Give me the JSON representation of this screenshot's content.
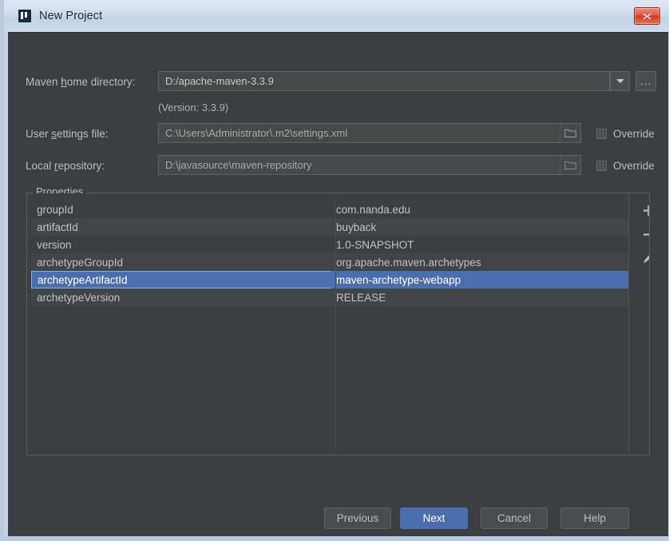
{
  "window": {
    "title": "New Project",
    "app_icon": "intellij-idea-icon",
    "close_label": "close-icon",
    "frame_color": "#b9cbdd",
    "dialog_bg": "#3c3f41"
  },
  "form": {
    "maven_home": {
      "label_pre": "Maven ",
      "label_mnemonic": "h",
      "label_post": "ome directory:",
      "value": "D:/apache-maven-3.3.9",
      "dropdown_icon": "chevron-down-icon",
      "browse_label": "..."
    },
    "version_note": "(Version: 3.3.9)",
    "user_settings": {
      "label_pre": "User ",
      "label_mnemonic": "s",
      "label_post": "ettings file:",
      "value": "C:\\Users\\Administrator\\.m2\\settings.xml",
      "folder_icon": "folder-icon",
      "override_label": "Override",
      "override_checked": false
    },
    "local_repository": {
      "label_pre": "Local ",
      "label_mnemonic": "r",
      "label_post": "epository:",
      "value": "D:\\javasource\\maven-repository",
      "folder_icon": "folder-icon",
      "override_label": "Override",
      "override_checked": false
    }
  },
  "properties": {
    "legend": "Properties",
    "selected_index": 4,
    "selection_color": "#4b6eaf",
    "rows": [
      {
        "key": "groupId",
        "value": "com.nanda.edu"
      },
      {
        "key": "artifactId",
        "value": "buyback"
      },
      {
        "key": "version",
        "value": "1.0-SNAPSHOT"
      },
      {
        "key": "archetypeGroupId",
        "value": "org.apache.maven.archetypes"
      },
      {
        "key": "archetypeArtifactId",
        "value": "maven-archetype-webapp"
      },
      {
        "key": "archetypeVersion",
        "value": "RELEASE"
      }
    ],
    "tools": [
      {
        "name": "add-property-button",
        "icon": "plus-icon"
      },
      {
        "name": "remove-property-button",
        "icon": "minus-icon"
      },
      {
        "name": "edit-property-button",
        "icon": "pencil-icon"
      }
    ]
  },
  "footer": {
    "previous": "Previous",
    "next": "Next",
    "cancel": "Cancel",
    "help": "Help"
  }
}
